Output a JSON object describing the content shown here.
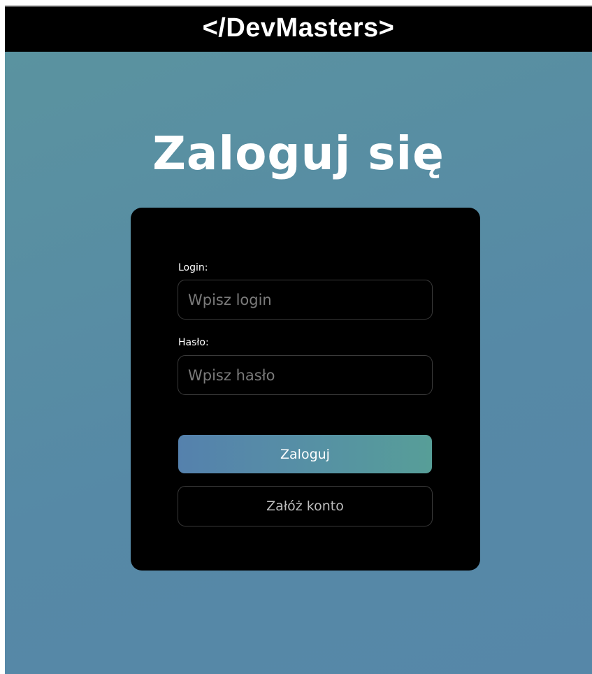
{
  "header": {
    "brand": "</DevMasters>"
  },
  "page": {
    "title": "Zaloguj się"
  },
  "form": {
    "login_label": "Login:",
    "login_placeholder": "Wpisz login",
    "login_value": "",
    "password_label": "Hasło:",
    "password_placeholder": "Wpisz hasło",
    "password_value": "",
    "submit_label": "Zaloguj",
    "register_label": "Załóż konto"
  },
  "colors": {
    "background_gradient_start": "#5b949f",
    "background_gradient_end": "#5687a8",
    "header_bg": "#000000",
    "card_bg": "#000000",
    "primary_button_gradient_start": "#5581ad",
    "primary_button_gradient_end": "#579e98"
  }
}
